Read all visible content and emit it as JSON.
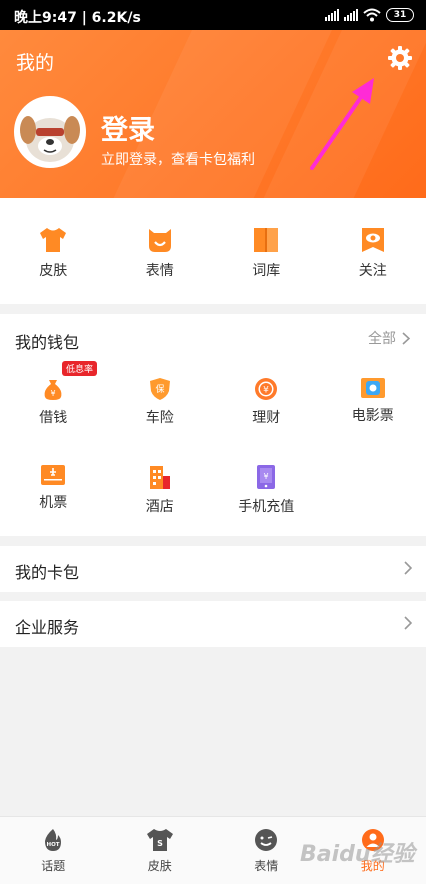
{
  "status": {
    "time": "晚上9:47 | 6.2K/s",
    "battery": "31"
  },
  "header": {
    "title": "我的",
    "login_title": "登录",
    "login_sub": "立即登录，查看卡包福利"
  },
  "quick": [
    {
      "label": "皮肤",
      "icon": "tshirt-icon"
    },
    {
      "label": "表情",
      "icon": "smile-icon"
    },
    {
      "label": "词库",
      "icon": "book-icon"
    },
    {
      "label": "关注",
      "icon": "eye-icon"
    }
  ],
  "wallet": {
    "title": "我的钱包",
    "all_label": "全部",
    "badge": "低息率",
    "items": [
      {
        "label": "借钱",
        "icon": "money-bag-icon"
      },
      {
        "label": "车险",
        "icon": "shield-icon"
      },
      {
        "label": "理财",
        "icon": "yuan-coin-icon"
      },
      {
        "label": "电影票",
        "icon": "movie-ticket-icon"
      },
      {
        "label": "机票",
        "icon": "plane-ticket-icon"
      },
      {
        "label": "酒店",
        "icon": "hotel-icon"
      },
      {
        "label": "手机充值",
        "icon": "phone-recharge-icon"
      }
    ]
  },
  "rows": {
    "card_pack": "我的卡包",
    "enterprise": "企业服务"
  },
  "tabs": [
    {
      "label": "话题",
      "icon": "hot-topic-icon"
    },
    {
      "label": "皮肤",
      "icon": "tshirt-icon"
    },
    {
      "label": "表情",
      "icon": "emoji-icon"
    },
    {
      "label": "我的",
      "icon": "user-icon"
    }
  ],
  "watermark": "Baidu经验",
  "colors": {
    "accent": "#ff6b1a",
    "icon": "#ff8a24",
    "badge": "#e8262b",
    "arrow": "#ff2bd6"
  }
}
